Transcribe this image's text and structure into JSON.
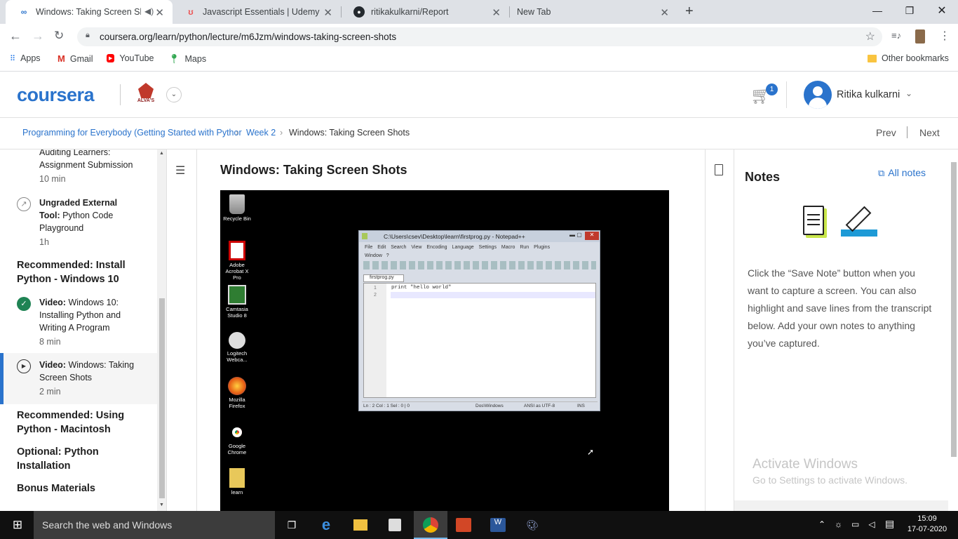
{
  "browser": {
    "tabs": [
      {
        "title": "Windows: Taking Screen Sho",
        "icon": "coursera-favicon"
      },
      {
        "title": "Javascript Essentials | Udemy",
        "icon": "udemy-favicon"
      },
      {
        "title": "ritikakulkarni/Report",
        "icon": "github-favicon"
      },
      {
        "title": "New Tab",
        "icon": ""
      }
    ],
    "url": "coursera.org/learn/python/lecture/m6Jzm/windows-taking-screen-shots",
    "bookmarks": [
      "Apps",
      "Gmail",
      "YouTube",
      "Maps"
    ],
    "other_bookmarks": "Other bookmarks"
  },
  "header": {
    "logo": "coursera",
    "org": "ALVA'S",
    "cart_count": "1",
    "user_name": "Ritika kulkarni"
  },
  "breadcrumb": {
    "course": "Programming for Everybody (Getting Started with Pythor",
    "week": "Week 2",
    "current": "Windows: Taking Screen Shots",
    "prev": "Prev",
    "next": "Next"
  },
  "sidebar": {
    "item0": {
      "line1": "Auditing Learners:",
      "line2": "Assignment Submission",
      "duration": "10 min"
    },
    "item1": {
      "type": "Ungraded External",
      "line1": "Tool:",
      "line1b": " Python Code",
      "line2": "Playground",
      "duration": "1h"
    },
    "section1": "Recommended: Install Python - Windows 10",
    "item2": {
      "type": "Video:",
      "line1": " Windows 10:",
      "line2": "Installing Python and",
      "line3": "Writing A Program",
      "duration": "8 min"
    },
    "item3": {
      "type": "Video:",
      "line1": " Windows: Taking",
      "line2": "Screen Shots",
      "duration": "2 min"
    },
    "section2": "Recommended: Using Python - Macintosh",
    "section3": "Optional: Python Installation",
    "section4": "Bonus Materials"
  },
  "content": {
    "title": "Windows: Taking Screen Shots",
    "desktop_icons": [
      "Recycle Bin",
      "Adobe Acrobat X Pro",
      "Camtasia Studio 8",
      "Logitech Webca...",
      "Mozilla Firefox",
      "Google Chrome",
      "learn"
    ],
    "notepad": {
      "title": "C:\\Users\\csev\\Desktop\\learn\\firstprog.py - Notepad++",
      "menu": [
        "File",
        "Edit",
        "Search",
        "View",
        "Encoding",
        "Language",
        "Settings",
        "Macro",
        "Run",
        "Plugins"
      ],
      "menu2": "Window   ?",
      "tab": "firstprog.py",
      "line1": "print \"hello world\"",
      "status_left": "Ln : 2    Col : 1    Sel : 0 | 0",
      "status_mid": "Dos\\Windows",
      "status_enc": "ANSI as UTF-8",
      "status_ins": "INS"
    }
  },
  "notes": {
    "title": "Notes",
    "all_notes": "All notes",
    "text": "Click the “Save Note” button when you want to capture a screen. You can also highlight and save lines from the transcript below. Add your own notes to anything you’ve captured.",
    "watermark1": "Activate Windows",
    "watermark2": "Go to Settings to activate Windows."
  },
  "taskbar": {
    "search": "Search the web and Windows",
    "time": "15:09",
    "date": "17-07-2020"
  },
  "colors": {
    "accent": "#2a73cc",
    "link": "#2a73cc",
    "check": "#1f8354"
  }
}
